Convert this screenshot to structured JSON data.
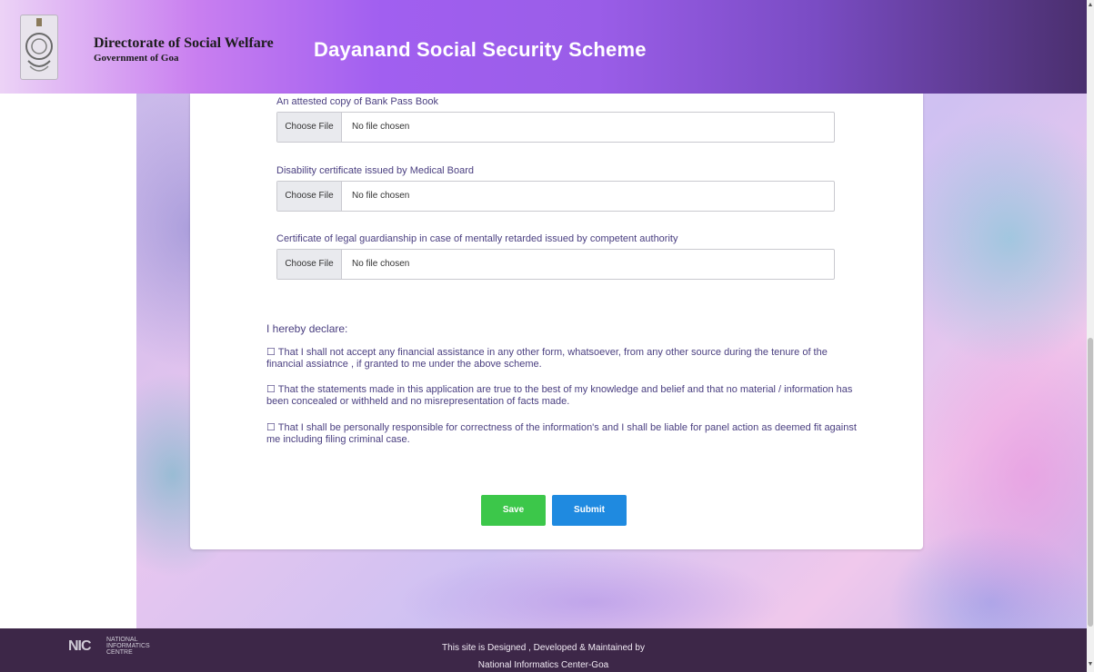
{
  "header": {
    "org_title": "Directorate of Social Welfare",
    "org_subtitle": "Government of Goa",
    "scheme_title": "Dayanand Social Security Scheme"
  },
  "uploads": [
    {
      "label": "An attested copy of Bank Pass Book",
      "button": "Choose File",
      "status": "No file chosen"
    },
    {
      "label": "Disability certificate issued by Medical Board",
      "button": "Choose File",
      "status": "No file chosen"
    },
    {
      "label": "Certificate of legal guardianship in case of mentally retarded issued by competent authority",
      "button": "Choose File",
      "status": "No file chosen"
    }
  ],
  "declaration": {
    "heading": "I hereby declare:",
    "items": [
      {
        "checkbox": "☐",
        "text": "That I shall not accept any financial assistance in any other form, whatsoever, from any other source during the tenure of the financial assiatnce , if granted to me under the above scheme."
      },
      {
        "checkbox": "☐",
        "text": "That the statements made in this application are true to the best of my knowledge and belief and that no material / information has been concealed or withheld and no misrepresentation of facts made."
      },
      {
        "checkbox": "☐",
        "text": "That I shall be personally responsible for correctness of the information's and I shall be liable for panel action as deemed fit against me including filing criminal case."
      }
    ]
  },
  "actions": {
    "save_label": "Save",
    "submit_label": "Submit"
  },
  "footer": {
    "nic_mark": "NIC",
    "nic_text_1": "NATIONAL",
    "nic_text_2": "INFORMATICS",
    "nic_text_3": "CENTRE",
    "line1": "This site is Designed , Developed & Maintained by",
    "line2": "National Informatics Center-Goa"
  },
  "scrollbar": {
    "up_arrow": "▲",
    "down_arrow": "▼"
  },
  "colors": {
    "save": "#3cc74a",
    "submit": "#1f8ae0",
    "footer_bg": "#3d2748",
    "label_text": "#4a3f80"
  }
}
